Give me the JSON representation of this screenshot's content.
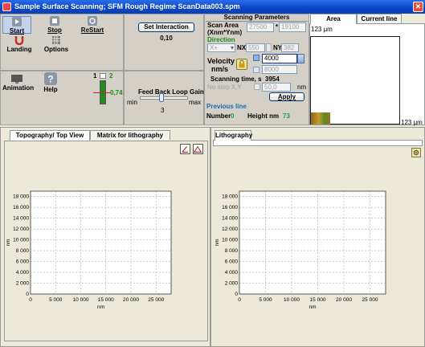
{
  "window": {
    "title": "Sample Surface Scanning; SFM Rough Regime  ScanData003.spm"
  },
  "toolbar": {
    "start": "Start",
    "stop": "Stop",
    "restart": "ReStart",
    "landing": "Landing",
    "options": "Options",
    "animation": "Animation",
    "help": "Help"
  },
  "indicator": {
    "left": "1",
    "right": "2",
    "value": "0,74"
  },
  "interaction": {
    "button": "Set Interaction",
    "value": "0,10"
  },
  "feedback": {
    "label": "Feed Back Loop Gain",
    "min": "min",
    "max": "max",
    "value": "3",
    "level": 0.45
  },
  "scan": {
    "header": "Scanning Parameters",
    "area_label_1": "Scan Area",
    "area_label_2": "(Xnm*Ynm)",
    "area_x": "27500",
    "area_sep": "*",
    "area_y": "19100",
    "direction_label": "Direction",
    "direction_value": "X+",
    "nx_label": "NX",
    "nx_value": "550",
    "ny_label": "NY",
    "ny_value": "382",
    "velocity_label_1": "Velocity",
    "velocity_label_2": "nm/s",
    "velocity_value": "4000",
    "velocity_value2": "8000",
    "time_label": "Scanning time, s",
    "time_value": "3954",
    "nostep_label": "No step X,Y",
    "nostep_value": "50,0",
    "nostep_unit": "nm",
    "apply": "Apply"
  },
  "previous": {
    "header": "Previous line",
    "number_label": "Number",
    "number_value": "0",
    "height_label": "Height nm",
    "height_value": "73"
  },
  "area_view": {
    "tabs": [
      "Area",
      "Current line"
    ],
    "top_label": "123 µm",
    "right_label": "123 µm"
  },
  "left_pane": {
    "tabs": [
      "Topography/ Top View",
      "Matrix for lithography"
    ]
  },
  "right_pane": {
    "tabs": [
      "Lithography"
    ]
  },
  "chart_data": [
    {
      "type": "line",
      "xlabel": "nm",
      "ylabel": "nm",
      "xlim": [
        0,
        28000
      ],
      "ylim": [
        0,
        19000
      ],
      "xticks": [
        "0",
        "5 000",
        "10 000",
        "15 000",
        "20 000",
        "25 000"
      ],
      "yticks": [
        "0",
        "2 000",
        "4 000",
        "6 000",
        "8 000",
        "10 000",
        "12 000",
        "14 000",
        "16 000",
        "18 000"
      ],
      "grid": true,
      "series": []
    },
    {
      "type": "line",
      "xlabel": "nm",
      "ylabel": "nm",
      "xlim": [
        0,
        28000
      ],
      "ylim": [
        0,
        19000
      ],
      "xticks": [
        "0",
        "5 000",
        "10 000",
        "15 000",
        "20 000",
        "25 000"
      ],
      "yticks": [
        "0",
        "2 000",
        "4 000",
        "6 000",
        "8 000",
        "10 000",
        "12 000",
        "14 000",
        "16 000",
        "18 000"
      ],
      "grid": true,
      "series": []
    }
  ]
}
